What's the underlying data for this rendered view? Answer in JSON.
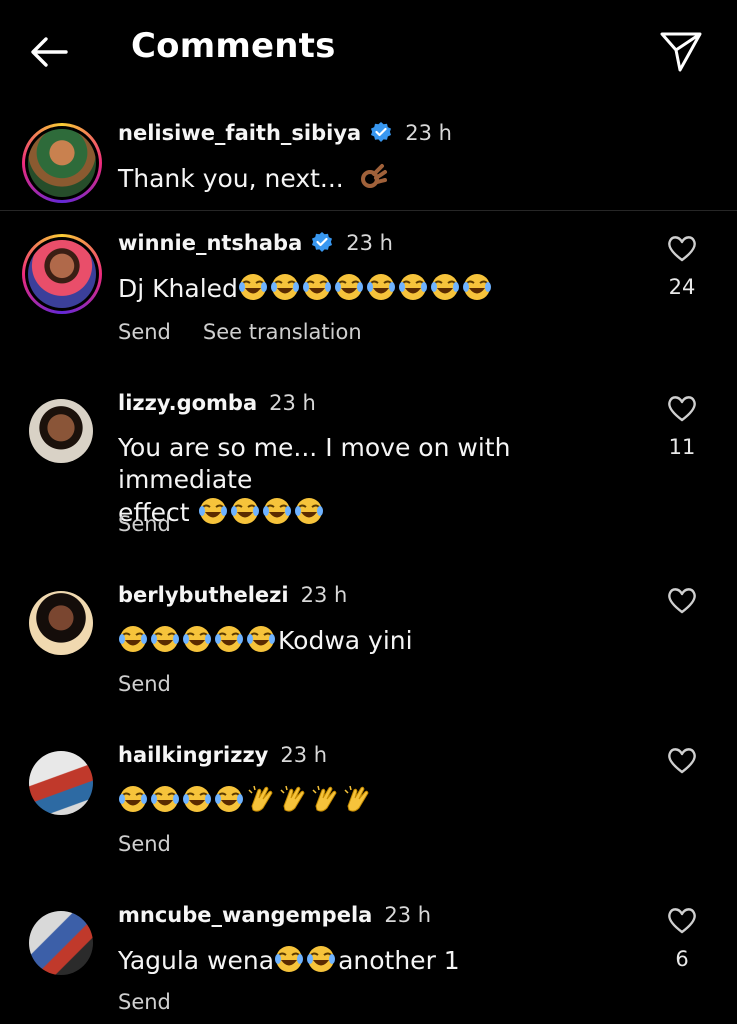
{
  "header": {
    "title": "Comments",
    "back_icon": "arrow-left-icon",
    "dm_icon": "paper-plane-icon"
  },
  "comments": [
    {
      "username": "nelisiwe_faith_sibiya",
      "verified": true,
      "time": "23 h",
      "text": "Thank you, next...",
      "emoji": "ok-hand",
      "likes": "",
      "send_label": "",
      "translate_label": ""
    },
    {
      "username": "winnie_ntshaba",
      "verified": true,
      "time": "23 h",
      "text": "Dj Khaled",
      "emoji": "laughing-tears x8",
      "likes": "24",
      "send_label": "Send",
      "translate_label": "See translation"
    },
    {
      "username": "lizzy.gomba",
      "verified": false,
      "time": "23 h",
      "text_line1": "You are so me... I move on with immediate",
      "text_line2": "effect",
      "emoji": "laughing-tears x4",
      "likes": "11",
      "send_label": "Send"
    },
    {
      "username": "berlybuthelezi",
      "verified": false,
      "time": "23 h",
      "text": "Kodwa yini",
      "emoji": "laughing-tears x5",
      "likes": "",
      "send_label": "Send"
    },
    {
      "username": "hailkingrizzy",
      "verified": false,
      "time": "23 h",
      "text": "",
      "emoji": "laughing-tears x4, clapping x4",
      "likes": "",
      "send_label": "Send"
    },
    {
      "username": "mncube_wangempela",
      "verified": false,
      "time": "23 h",
      "text_before": "Yagula wena",
      "text_after": "another 1",
      "emoji": "laughing-tears x2",
      "likes": "6",
      "send_label": "Send"
    }
  ],
  "colors": {
    "background": "#000000",
    "text": "#f5f5f5",
    "verified": "#3897f0",
    "divider": "#262626",
    "emoji": "#f6c33b"
  }
}
